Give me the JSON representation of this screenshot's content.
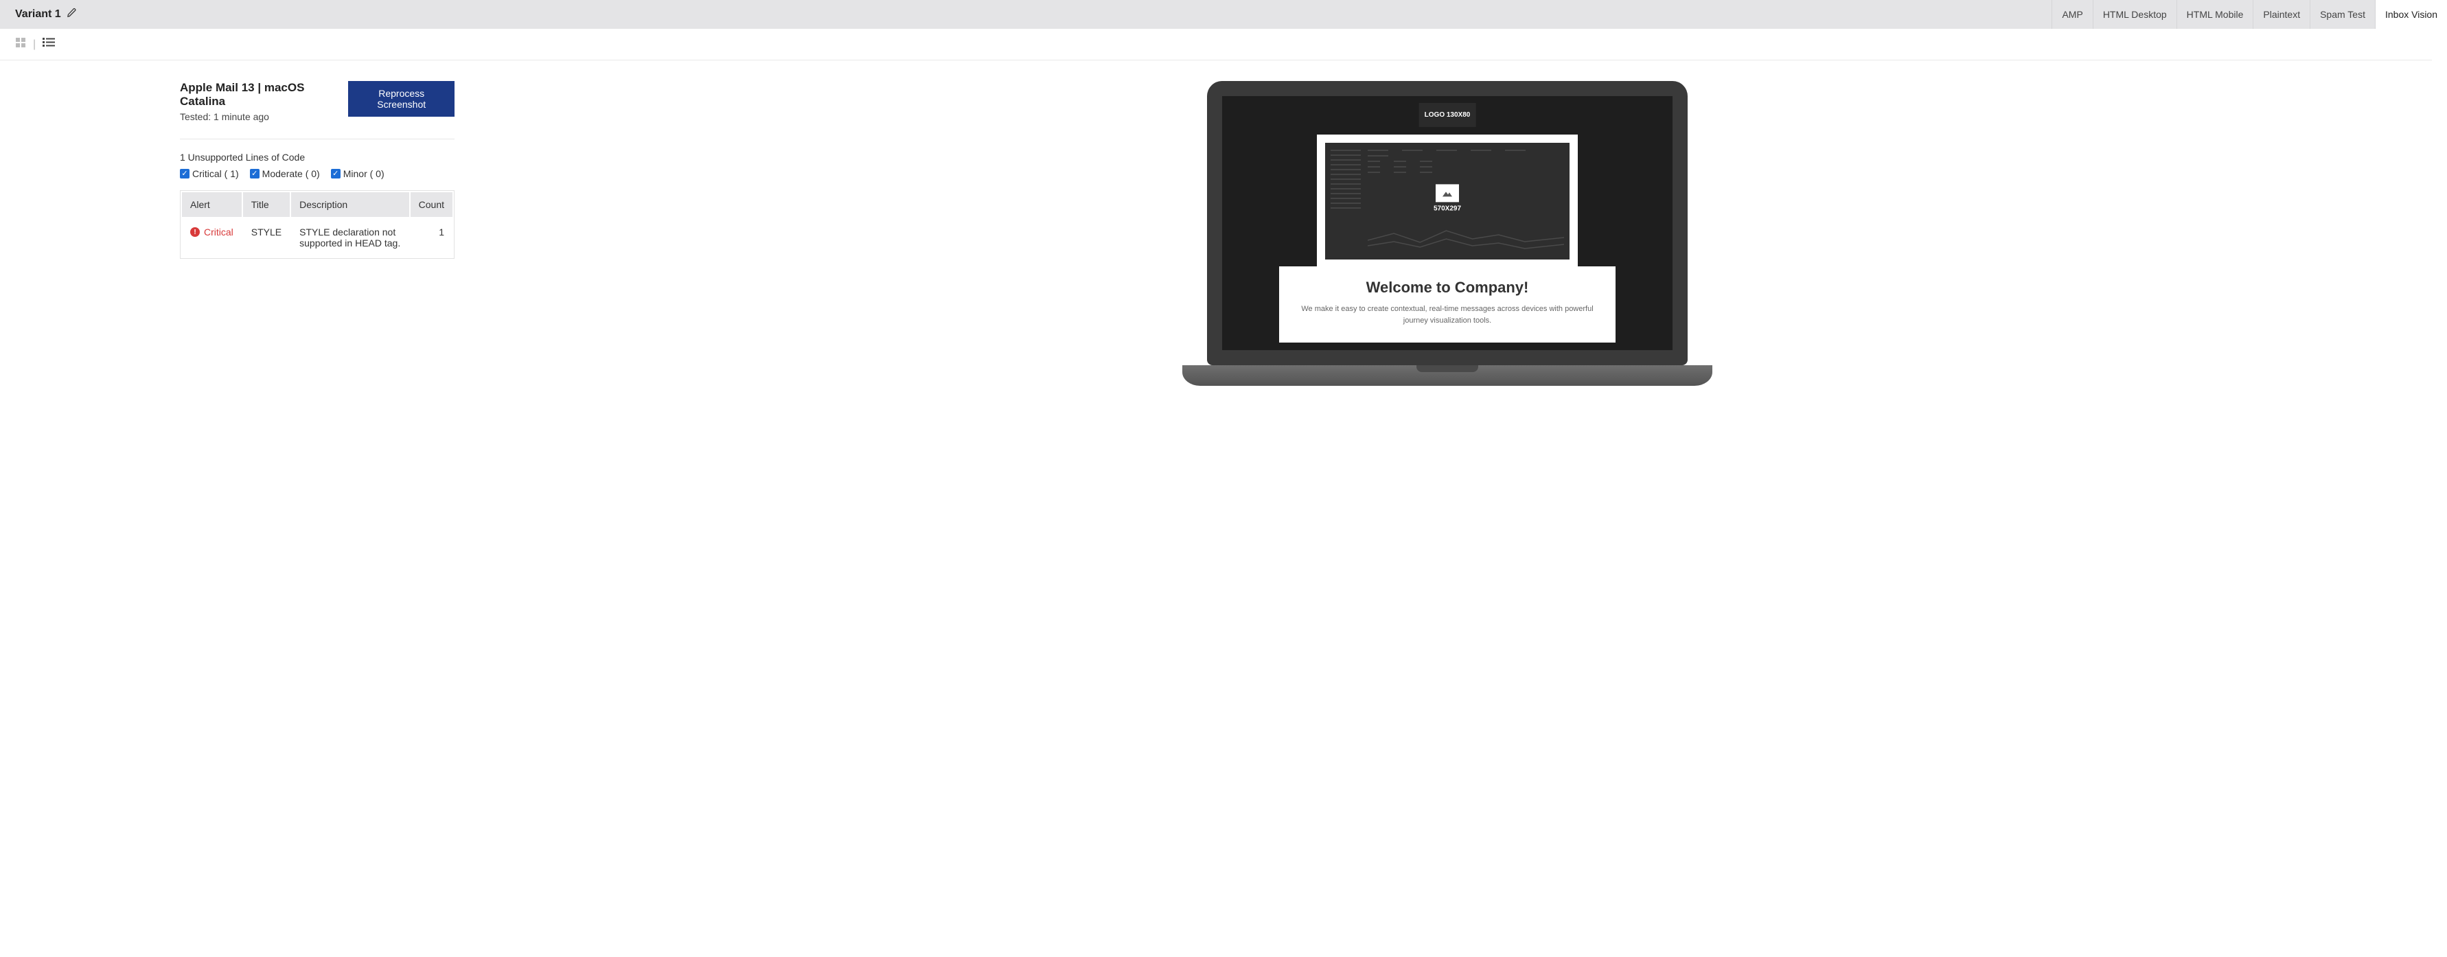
{
  "header": {
    "variant_label": "Variant 1",
    "tabs": [
      {
        "label": "AMP"
      },
      {
        "label": "HTML Desktop"
      },
      {
        "label": "HTML Mobile"
      },
      {
        "label": "Plaintext"
      },
      {
        "label": "Spam Test"
      },
      {
        "label": "Inbox Vision",
        "active": true
      }
    ]
  },
  "view_toggle": {
    "grid_active": false,
    "list_active": true
  },
  "client": {
    "name": "Apple Mail 13 | macOS Catalina",
    "tested": "Tested: 1 minute ago",
    "reprocess_label": "Reprocess Screenshot"
  },
  "issues": {
    "summary": "1 Unsupported Lines of Code",
    "filters": {
      "critical": "Critical ( 1)",
      "moderate": "Moderate ( 0)",
      "minor": "Minor ( 0)"
    },
    "columns": {
      "alert": "Alert",
      "title": "Title",
      "description": "Description",
      "count": "Count"
    },
    "rows": [
      {
        "alert": "Critical",
        "title": "STYLE",
        "description": "STYLE declaration not supported in HEAD tag.",
        "count": "1"
      }
    ]
  },
  "preview": {
    "logo_text": "LOGO 130X80",
    "image_dim": "570X297",
    "welcome_title": "Welcome to Company!",
    "welcome_sub": "We make it easy to create contextual, real-time messages across devices with powerful journey visualization tools."
  }
}
